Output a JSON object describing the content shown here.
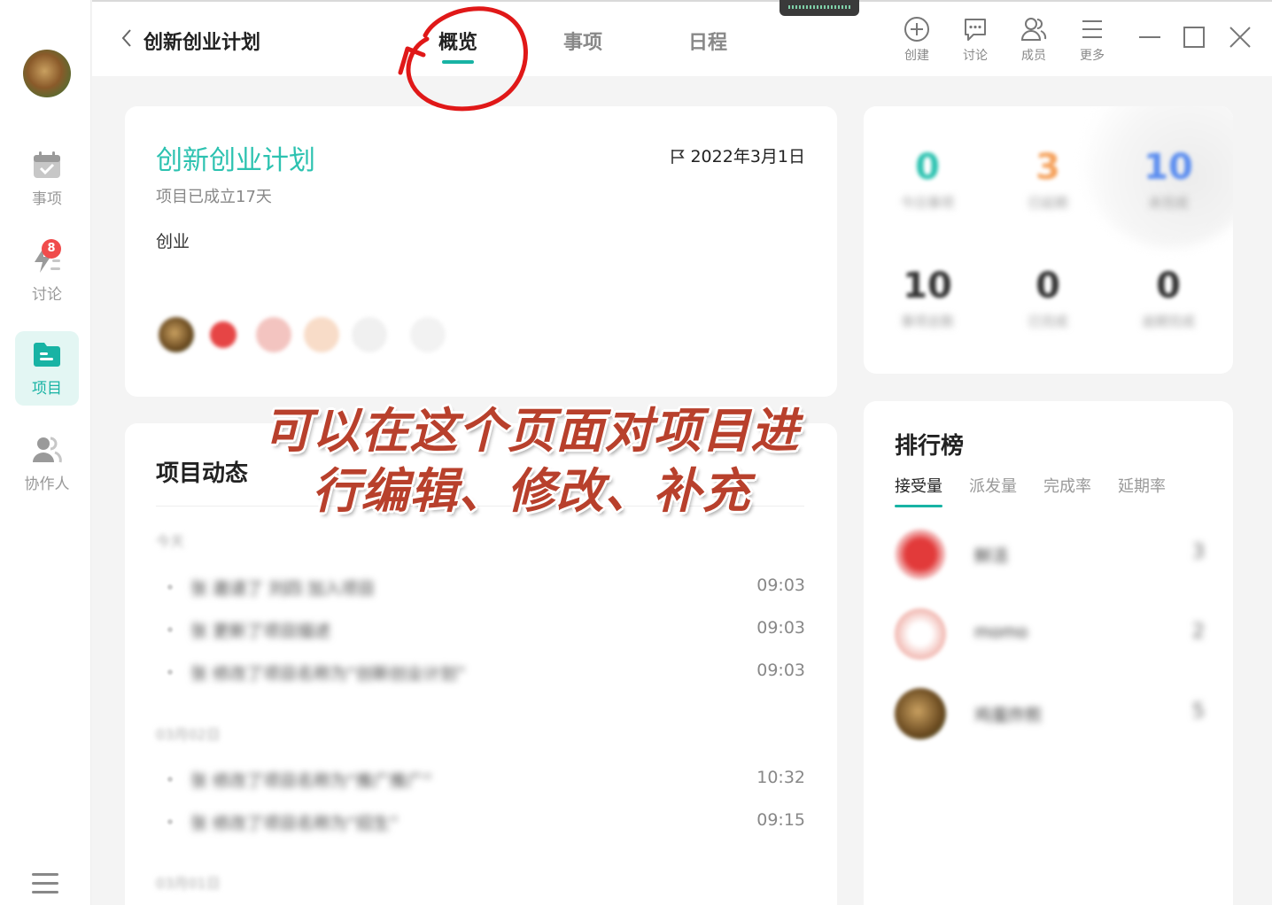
{
  "rail": {
    "items": [
      {
        "label": "事项",
        "icon": "calendar-check-icon"
      },
      {
        "label": "讨论",
        "icon": "lightning-list-icon",
        "badge": "8"
      },
      {
        "label": "项目",
        "icon": "folder-icon",
        "active": true
      },
      {
        "label": "协作人",
        "icon": "people-icon"
      }
    ]
  },
  "topbar": {
    "back_icon": "chevron-left-icon",
    "title": "创新创业计划",
    "tabs": [
      {
        "label": "概览",
        "active": true
      },
      {
        "label": "事项"
      },
      {
        "label": "日程"
      }
    ],
    "tools": [
      {
        "label": "创建",
        "icon": "plus-circle-icon"
      },
      {
        "label": "讨论",
        "icon": "chat-icon"
      },
      {
        "label": "成员",
        "icon": "members-icon"
      },
      {
        "label": "更多",
        "icon": "menu-icon"
      }
    ]
  },
  "project": {
    "name": "创新创业计划",
    "established": "项目已成立17天",
    "description": "创业",
    "start_date": "2022年3月1日"
  },
  "feed": {
    "title": "项目动态",
    "groups": [
      {
        "date": "今天",
        "items": [
          {
            "text": "张 邀请了 刘四 加入项目",
            "time": "09:03"
          },
          {
            "text": "张 更新了项目描述",
            "time": "09:03"
          },
          {
            "text": "张 修改了项目名称为“创新创业计划”",
            "time": "09:03"
          }
        ]
      },
      {
        "date": "03月02日",
        "items": [
          {
            "text": "张 修改了项目名称为“推广推广”",
            "time": "10:32"
          },
          {
            "text": "张 修改了项目名称为“招生”",
            "time": "09:15"
          }
        ]
      },
      {
        "date": "03月01日",
        "items": []
      }
    ]
  },
  "stats": [
    {
      "value": "0",
      "label": "今日事项",
      "color": "#2cc2b0"
    },
    {
      "value": "3",
      "label": "已延期",
      "color": "#f5a25d"
    },
    {
      "value": "10",
      "label": "未完成",
      "color": "#5b8def"
    },
    {
      "value": "10",
      "label": "事项总数",
      "color": "#333333"
    },
    {
      "value": "0",
      "label": "已完成",
      "color": "#333333"
    },
    {
      "value": "0",
      "label": "逾期完成",
      "color": "#333333"
    }
  ],
  "ranking": {
    "title": "排行榜",
    "tabs": [
      "接受量",
      "派发量",
      "完成率",
      "延期率"
    ],
    "rows": [
      {
        "name": "鲜活",
        "value": "3"
      },
      {
        "name": "momo",
        "value": "2"
      },
      {
        "name": "鸡蛋炸煎",
        "value": "5"
      }
    ]
  },
  "annotation": {
    "caption_line1": "可以在这个页面对项目进",
    "caption_line2": "行编辑、修改、补充"
  },
  "colors": {
    "accent": "#18b3a4",
    "project_name": "#2cc2b0",
    "badge": "#f04b4b",
    "annotation": "#b8402c",
    "circle": "#e01818"
  }
}
